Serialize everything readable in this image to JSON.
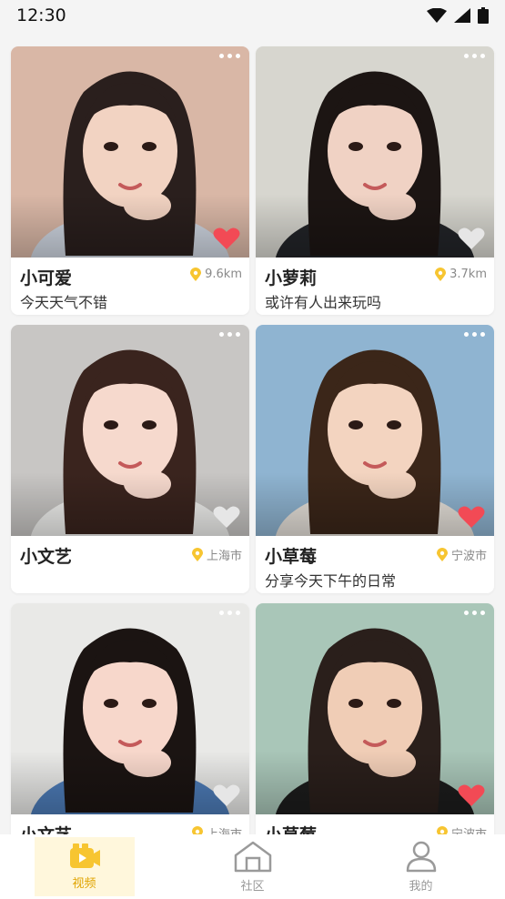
{
  "status_bar": {
    "time": "12:30"
  },
  "cards": [
    {
      "name": "小可爱",
      "location": "9.6km",
      "status": "今天天气不错",
      "liked": true,
      "bg": "#d9b7a6",
      "hair": "#2a1f1d",
      "skin": "#f2d3c2",
      "cloth": "#cfd6e1"
    },
    {
      "name": "小萝莉",
      "location": "3.7km",
      "status": "或许有人出来玩吗",
      "liked": false,
      "bg": "#d7d6cf",
      "hair": "#1c1513",
      "skin": "#f0d2c4",
      "cloth": "#222428"
    },
    {
      "name": "小文艺",
      "location": "上海市",
      "status": "",
      "liked": false,
      "bg": "#c8c6c4",
      "hair": "#3a241e",
      "skin": "#f6d9cd",
      "cloth": "#f1f1ef"
    },
    {
      "name": "小草莓",
      "location": "宁波市",
      "status": "分享今天下午的日常",
      "liked": true,
      "bg": "#8fb4d1",
      "hair": "#3b2619",
      "skin": "#f3d4c0",
      "cloth": "#e7e2db"
    },
    {
      "name": "小文艺",
      "location": "上海市",
      "status": "",
      "liked": false,
      "bg": "#e9e9e7",
      "hair": "#1b1412",
      "skin": "#f7d7cb",
      "cloth": "#4d7cb8"
    },
    {
      "name": "小草莓",
      "location": "宁波市",
      "status": "",
      "liked": true,
      "bg": "#a9c6b8",
      "hair": "#2a1f1b",
      "skin": "#f0cdb6",
      "cloth": "#1c1c1c"
    }
  ],
  "tabs": [
    {
      "label": "视频",
      "active": true
    },
    {
      "label": "社区",
      "active": false
    },
    {
      "label": "我的",
      "active": false
    }
  ],
  "colors": {
    "accent": "#f7c531",
    "heart_liked": "#f24a55",
    "heart_unliked": "#e6e6e6"
  }
}
